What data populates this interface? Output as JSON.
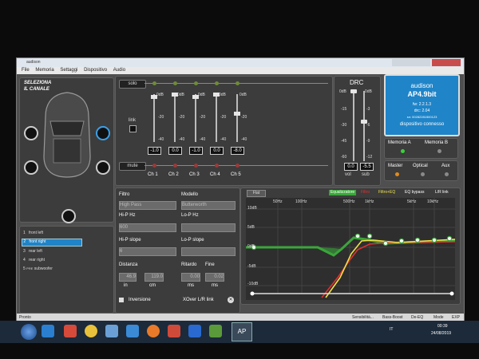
{
  "window": {
    "title": "audison",
    "menu": [
      "File",
      "Memoria",
      "Settaggi",
      "Dispositivo",
      "Audio"
    ]
  },
  "channel_select": {
    "title_line1": "SELEZIONA",
    "title_line2": "IL CANALE"
  },
  "channels_list": [
    {
      "num": "1",
      "name": "front left"
    },
    {
      "num": "2",
      "name": "front right",
      "selected": true
    },
    {
      "num": "3",
      "name": "rear left"
    },
    {
      "num": "4",
      "name": "rear right"
    },
    {
      "num": "5",
      "name": "subwoofer",
      "prefix": "PRE"
    }
  ],
  "mixer": {
    "solo": "solo",
    "mute": "mute",
    "link": "link",
    "scale": [
      "0dB",
      "-20",
      "-40"
    ],
    "channels": [
      {
        "label": "Ch 1",
        "value": "-1.0"
      },
      {
        "label": "Ch 2",
        "value": "0.0"
      },
      {
        "label": "Ch 3",
        "value": "-1.0"
      },
      {
        "label": "Ch 4",
        "value": "0.0"
      },
      {
        "label": "Ch 5",
        "value": "-8.0"
      }
    ]
  },
  "drc": {
    "title": "DRC",
    "vol_scale": [
      "0dB",
      "-15",
      "-30",
      "-45",
      "-60"
    ],
    "sub_scale": [
      "0dB",
      "-3",
      "-6",
      "-9",
      "-12"
    ],
    "vol_value": "0.0",
    "sub_value": "-5.5",
    "vol_label": "vol",
    "sub_label": "sub"
  },
  "device": {
    "brand": "audison",
    "model": "AP4.9bit",
    "fw": "fw: 2.2.1.3",
    "drc": "drc: 2.04",
    "sn": "sn: 00282281500123",
    "status": "dispositivo connesso"
  },
  "memoria": {
    "a": "Memoria A",
    "b": "Memoria B"
  },
  "inputs": {
    "master": "Master",
    "optical": "Optical",
    "aux": "Aux"
  },
  "filter": {
    "filtro_label": "Filtro",
    "filtro_value": "High Pass",
    "modello_label": "Modello",
    "modello_value": "Butterworth",
    "hip_hz_label": "Hi-P Hz",
    "hip_hz_value": "600",
    "lop_hz_label": "Lo-P Hz",
    "lop_hz_value": "",
    "hip_slope_label": "Hi-P slope",
    "hip_slope_value": "6",
    "lop_slope_label": "Lo-P slope",
    "lop_slope_value": "",
    "distanza_label": "Distanza",
    "dist_in": "46.9",
    "dist_cm": "119.0",
    "in_label": "in",
    "cm_label": "cm",
    "ritardo_label": "Ritardo",
    "ritardo_value": "0.00",
    "fine_label": "Fine",
    "fine_value": "0.02",
    "ms1": "ms",
    "ms2": "ms",
    "inversione": "Inversione",
    "xover": "XOver L/R link"
  },
  "eq": {
    "tab": "Flat",
    "equalizzatore": "Equalizzatore",
    "filtro": "Filtro",
    "filtro_eq": "Filtro+EQ",
    "eq_bypass": "EQ bypass",
    "lr_link": "L/R link",
    "y_labels": [
      "10dB",
      "5dB",
      "0dB",
      "-5dB",
      "-10dB"
    ],
    "x_labels": [
      "50Hz",
      "100Hz",
      "500Hz",
      "1kHz",
      "5kHz",
      "10kHz"
    ]
  },
  "statusbar": {
    "left": "Pronto",
    "sensitivity": "Sensibilità...",
    "bass_boost": "Bass-Boost",
    "de_eq": "De-EQ",
    "mode": "Mode",
    "exp": "EXP"
  },
  "taskbar": {
    "lang": "IT",
    "time": "00:39",
    "date": "24/08/2019",
    "app": "AP"
  },
  "colors": {
    "accent": "#1f84c8",
    "eq_green": "#3aa63a",
    "red": "#e13030",
    "yellow": "#f0e24a"
  }
}
